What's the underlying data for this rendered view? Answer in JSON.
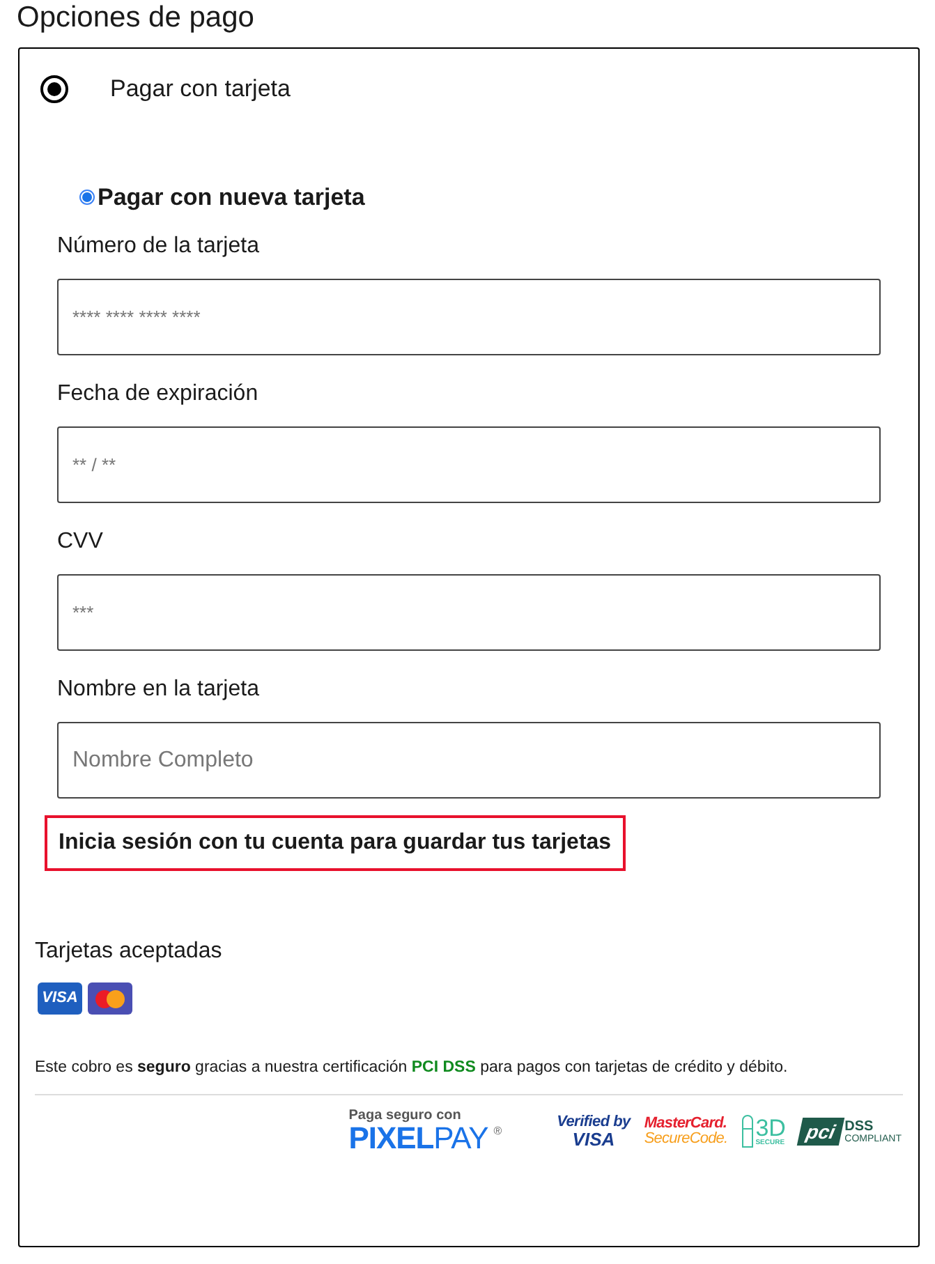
{
  "title": "Opciones de pago",
  "payment_options": [
    {
      "label": "Pagar con tarjeta",
      "selected": true
    }
  ],
  "card_options": [
    {
      "label": "Pagar con nueva tarjeta",
      "selected": true
    }
  ],
  "fields": [
    {
      "label": "Número de la tarjeta",
      "placeholder": "**** **** **** ****"
    },
    {
      "label": "Fecha de expiración",
      "placeholder": "** / **"
    },
    {
      "label": "CVV",
      "placeholder": "***"
    },
    {
      "label": "Nombre en la tarjeta",
      "placeholder": "Nombre Completo"
    }
  ],
  "login_notice": "Inicia sesión con tu cuenta para guardar tus tarjetas",
  "accepted_cards": {
    "title": "Tarjetas aceptadas",
    "cards": [
      {
        "kind": "visa",
        "text": "VISA"
      },
      {
        "kind": "mastercard"
      }
    ]
  },
  "security_note": [
    {
      "kind": "plain",
      "text": "Este cobro es "
    },
    {
      "kind": "bold",
      "text": "seguro"
    },
    {
      "kind": "plain",
      "text": " gracias a nuestra certificación "
    },
    {
      "kind": "highlight",
      "text": "PCI DSS"
    },
    {
      "kind": "plain",
      "text": " para pagos con tarjetas de crédito y débito."
    }
  ],
  "badges": [
    {
      "kind": "pixelpay",
      "lines": [
        "Paga seguro con",
        "PIXEL",
        "PAY",
        "®"
      ]
    },
    {
      "kind": "verified_visa",
      "lines": [
        "Verified by",
        "VISA"
      ]
    },
    {
      "kind": "securecode",
      "lines": [
        "MasterCard.",
        "SecureCode."
      ]
    },
    {
      "kind": "secure3d",
      "lines": [
        "3D",
        "SECURE"
      ]
    },
    {
      "kind": "pci",
      "lines": [
        "pci",
        "DSS",
        "COMPLIANT"
      ]
    }
  ]
}
